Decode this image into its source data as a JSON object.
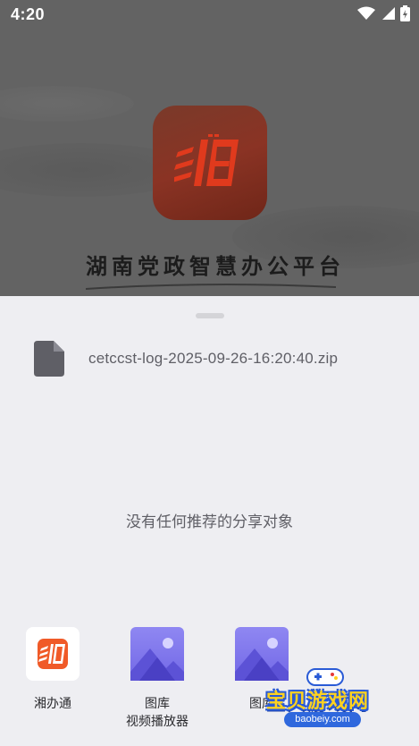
{
  "status_bar": {
    "time": "4:20"
  },
  "background": {
    "title_calligraphy": "湖南党政智慧办公平台"
  },
  "share_sheet": {
    "file_name": "cetccst-log-2025-09-26-16:20:40.zip",
    "empty_message": "没有任何推荐的分享对象",
    "targets": [
      {
        "label": "湘办通",
        "sublabel": "",
        "icon": "xiangbantong-app-icon"
      },
      {
        "label": "图库",
        "sublabel": "视频播放器",
        "icon": "gallery-icon"
      },
      {
        "label": "图库",
        "sublabel": "",
        "icon": "gallery-icon"
      }
    ]
  },
  "watermark": {
    "title": "宝贝游戏网",
    "url": "baobeiy.com"
  },
  "colors": {
    "sheet_bg": "#eeeef2",
    "scrim": "#636363",
    "gallery_purple": "#7e76ee",
    "brand_orange": "#f05a28"
  }
}
